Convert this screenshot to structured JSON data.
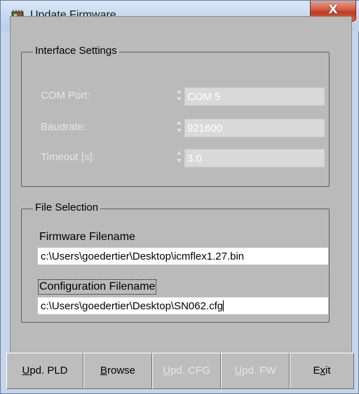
{
  "window": {
    "title": "Update Firmware",
    "close_symbol": "X",
    "app_icon": "firmware-chip-icon"
  },
  "interface_settings": {
    "title": "Interface Settings",
    "com_port": {
      "label": "COM Port:",
      "value": "COM 5"
    },
    "baudrate": {
      "label": "Baudrate:",
      "value": "921600"
    },
    "timeout": {
      "label": "Timeout [s]:",
      "value": "3.0"
    }
  },
  "file_selection": {
    "title": "File Selection",
    "firmware_label": "Firmware Filename",
    "firmware_value": "c:\\Users\\goedertier\\Desktop\\icmflex1.27.bin",
    "config_label": "Configuration Filename",
    "config_value": "c:\\Users\\goedertier\\Desktop\\SN062.cfg"
  },
  "buttons": [
    {
      "mnemonic": "U",
      "rest": "pd. PLD",
      "enabled": true
    },
    {
      "mnemonic": "B",
      "rest": "rowse",
      "enabled": true
    },
    {
      "mnemonic": "U",
      "rest": "pd. CFG",
      "enabled": false
    },
    {
      "mnemonic": "U",
      "rest": "pd. FW",
      "enabled": false
    },
    {
      "prefix": "E",
      "mnemonic": "x",
      "rest": "it",
      "enabled": true
    }
  ],
  "colors": {
    "frame": "#c5d6ec",
    "dialog_bg": "#bababa",
    "disabled_text": "#e6e6e6",
    "close_button": "#c33b21"
  }
}
